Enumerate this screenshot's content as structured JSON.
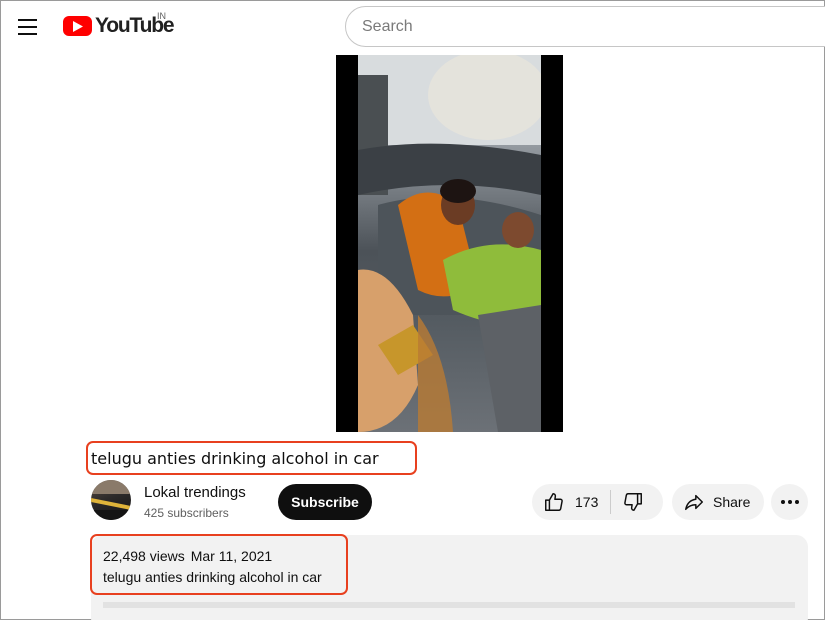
{
  "header": {
    "logo_text": "YouTube",
    "region": "IN",
    "search_placeholder": "Search",
    "icons": {
      "menu": "menu-icon",
      "logo": "youtube-play-icon"
    }
  },
  "video": {
    "title": "telugu anties drinking alcohol in car"
  },
  "channel": {
    "name": "Lokal trendings",
    "subscribers": "425 subscribers",
    "subscribe_label": "Subscribe"
  },
  "actions": {
    "like_count": "173",
    "share_label": "Share",
    "icons": {
      "like": "thumbs-up-icon",
      "dislike": "thumbs-down-icon",
      "share": "share-arrow-icon",
      "more": "more-horizontal-icon"
    }
  },
  "description": {
    "views": "22,498 views",
    "date": "Mar 11, 2021",
    "text": "telugu anties drinking alcohol in car"
  },
  "colors": {
    "brand_red": "#ff0000",
    "highlight": "#e8401f",
    "subscribe_bg": "#0f0f0f",
    "chip_bg": "#f2f2f2"
  }
}
